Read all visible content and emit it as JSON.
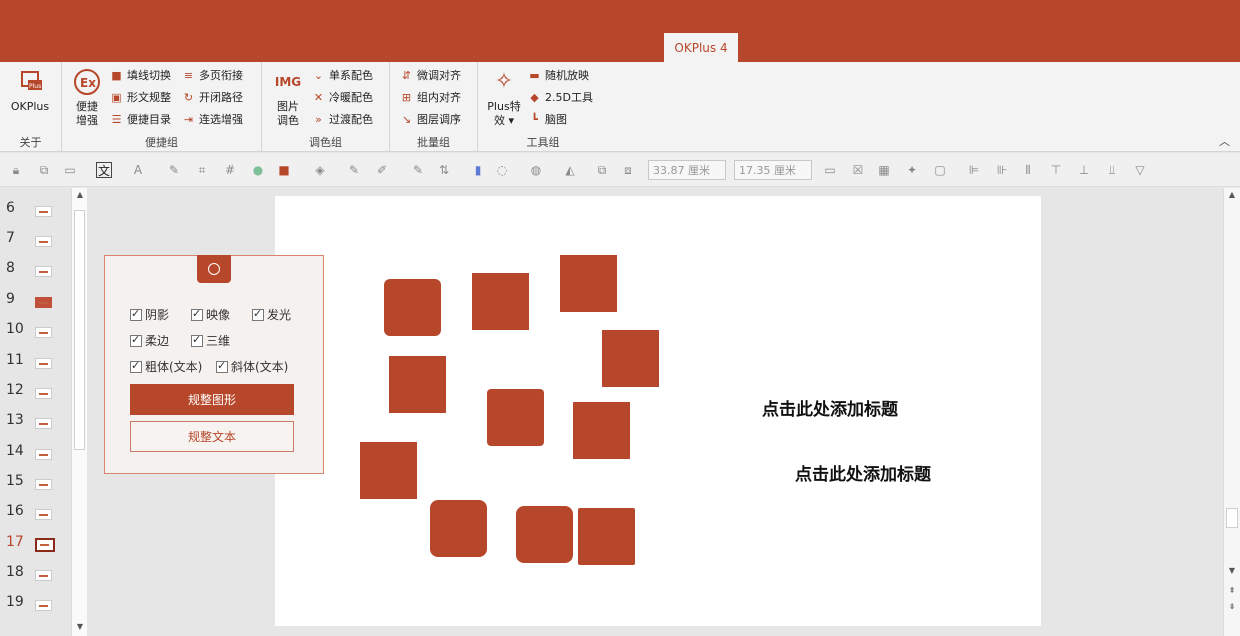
{
  "app": {
    "tab_label": "OKPlus 4"
  },
  "ribbon": {
    "about": {
      "button": "OKPlus",
      "label": "关于"
    },
    "convenience": {
      "big": "便捷\n增强",
      "items": [
        "填线切换",
        "多页衔接",
        "形文规整",
        "开闭路径",
        "便捷目录",
        "连选增强"
      ],
      "label": "便捷组"
    },
    "color": {
      "big_icon_text": "IMG",
      "big": "图片\n调色",
      "items": [
        "单系配色",
        "冷暖配色",
        "过渡配色"
      ],
      "label": "调色组"
    },
    "batch": {
      "items": [
        "微调对齐",
        "组内对齐",
        "图层调序"
      ],
      "label": "批量组"
    },
    "tools": {
      "big": "Plus特\n效 ▾",
      "items": [
        "随机放映",
        "2.5D工具",
        "脑图"
      ],
      "label": "工具组"
    }
  },
  "toolbar": {
    "width_value": "33.87 厘米",
    "height_value": "17.35 厘米"
  },
  "slides": {
    "numbers": [
      "6",
      "7",
      "8",
      "9",
      "10",
      "11",
      "12",
      "13",
      "14",
      "15",
      "16",
      "17",
      "18",
      "19"
    ],
    "active": "17"
  },
  "panel": {
    "checkboxes": [
      "阴影",
      "映像",
      "发光",
      "柔边",
      "三维",
      "粗体(文本)",
      "斜体(文本)"
    ],
    "primary_button": "规整图形",
    "secondary_button": "规整文本"
  },
  "slide": {
    "title_1": "点击此处添加标题",
    "title_2": "点击此处添加标题",
    "accent_color": "#b7472a"
  }
}
